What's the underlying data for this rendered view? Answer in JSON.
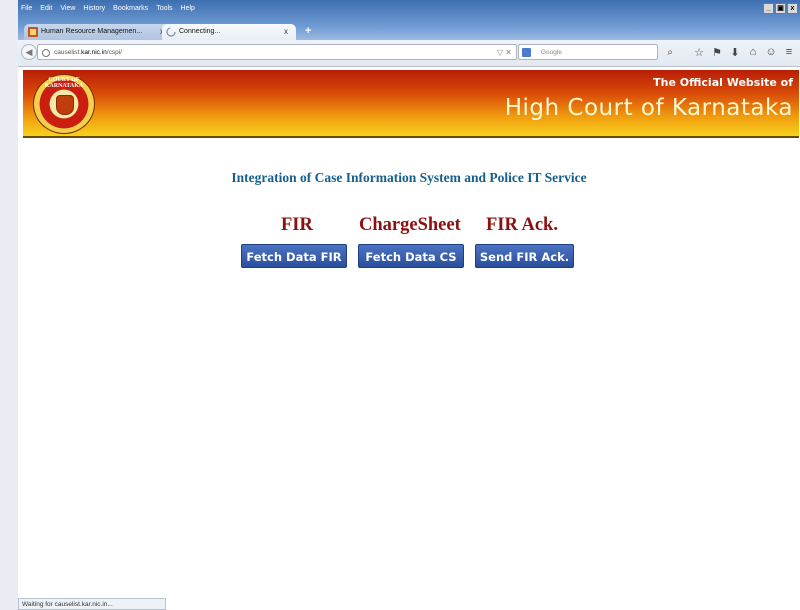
{
  "browser": {
    "menu": [
      "File",
      "Edit",
      "View",
      "History",
      "Bookmarks",
      "Tools",
      "Help"
    ],
    "window_controls": [
      "_",
      "е",
      "x"
    ],
    "tabs": [
      {
        "title": "Human Resource Managemen...",
        "close": "x"
      },
      {
        "title": "Connecting...",
        "close": "x"
      }
    ],
    "newtab": "+",
    "back": "◀",
    "url_prefix": "causelist.",
    "url_host": "kar.nic.in",
    "url_suffix": "/cspi/",
    "url_controls": "▽ ✕",
    "search_placeholder": "Google",
    "search_icon": "⌕",
    "toolbar_icons": [
      "☆",
      "⚑",
      "⬇",
      "⌂",
      "☺",
      "≡"
    ],
    "status": "Waiting for causelist.kar.nic.in..."
  },
  "site": {
    "logo_text": "COURT OF KARNATAKA",
    "subtitle": "The Official Website of",
    "title": "High Court of Karnataka"
  },
  "main": {
    "title": "Integration of Case Information System and Police IT Service",
    "columns": [
      {
        "heading": "FIR",
        "button": "Fetch Data FIR"
      },
      {
        "heading": "ChargeSheet",
        "button": "Fetch Data CS"
      },
      {
        "heading": "FIR Ack.",
        "button": "Send FIR Ack."
      }
    ]
  }
}
